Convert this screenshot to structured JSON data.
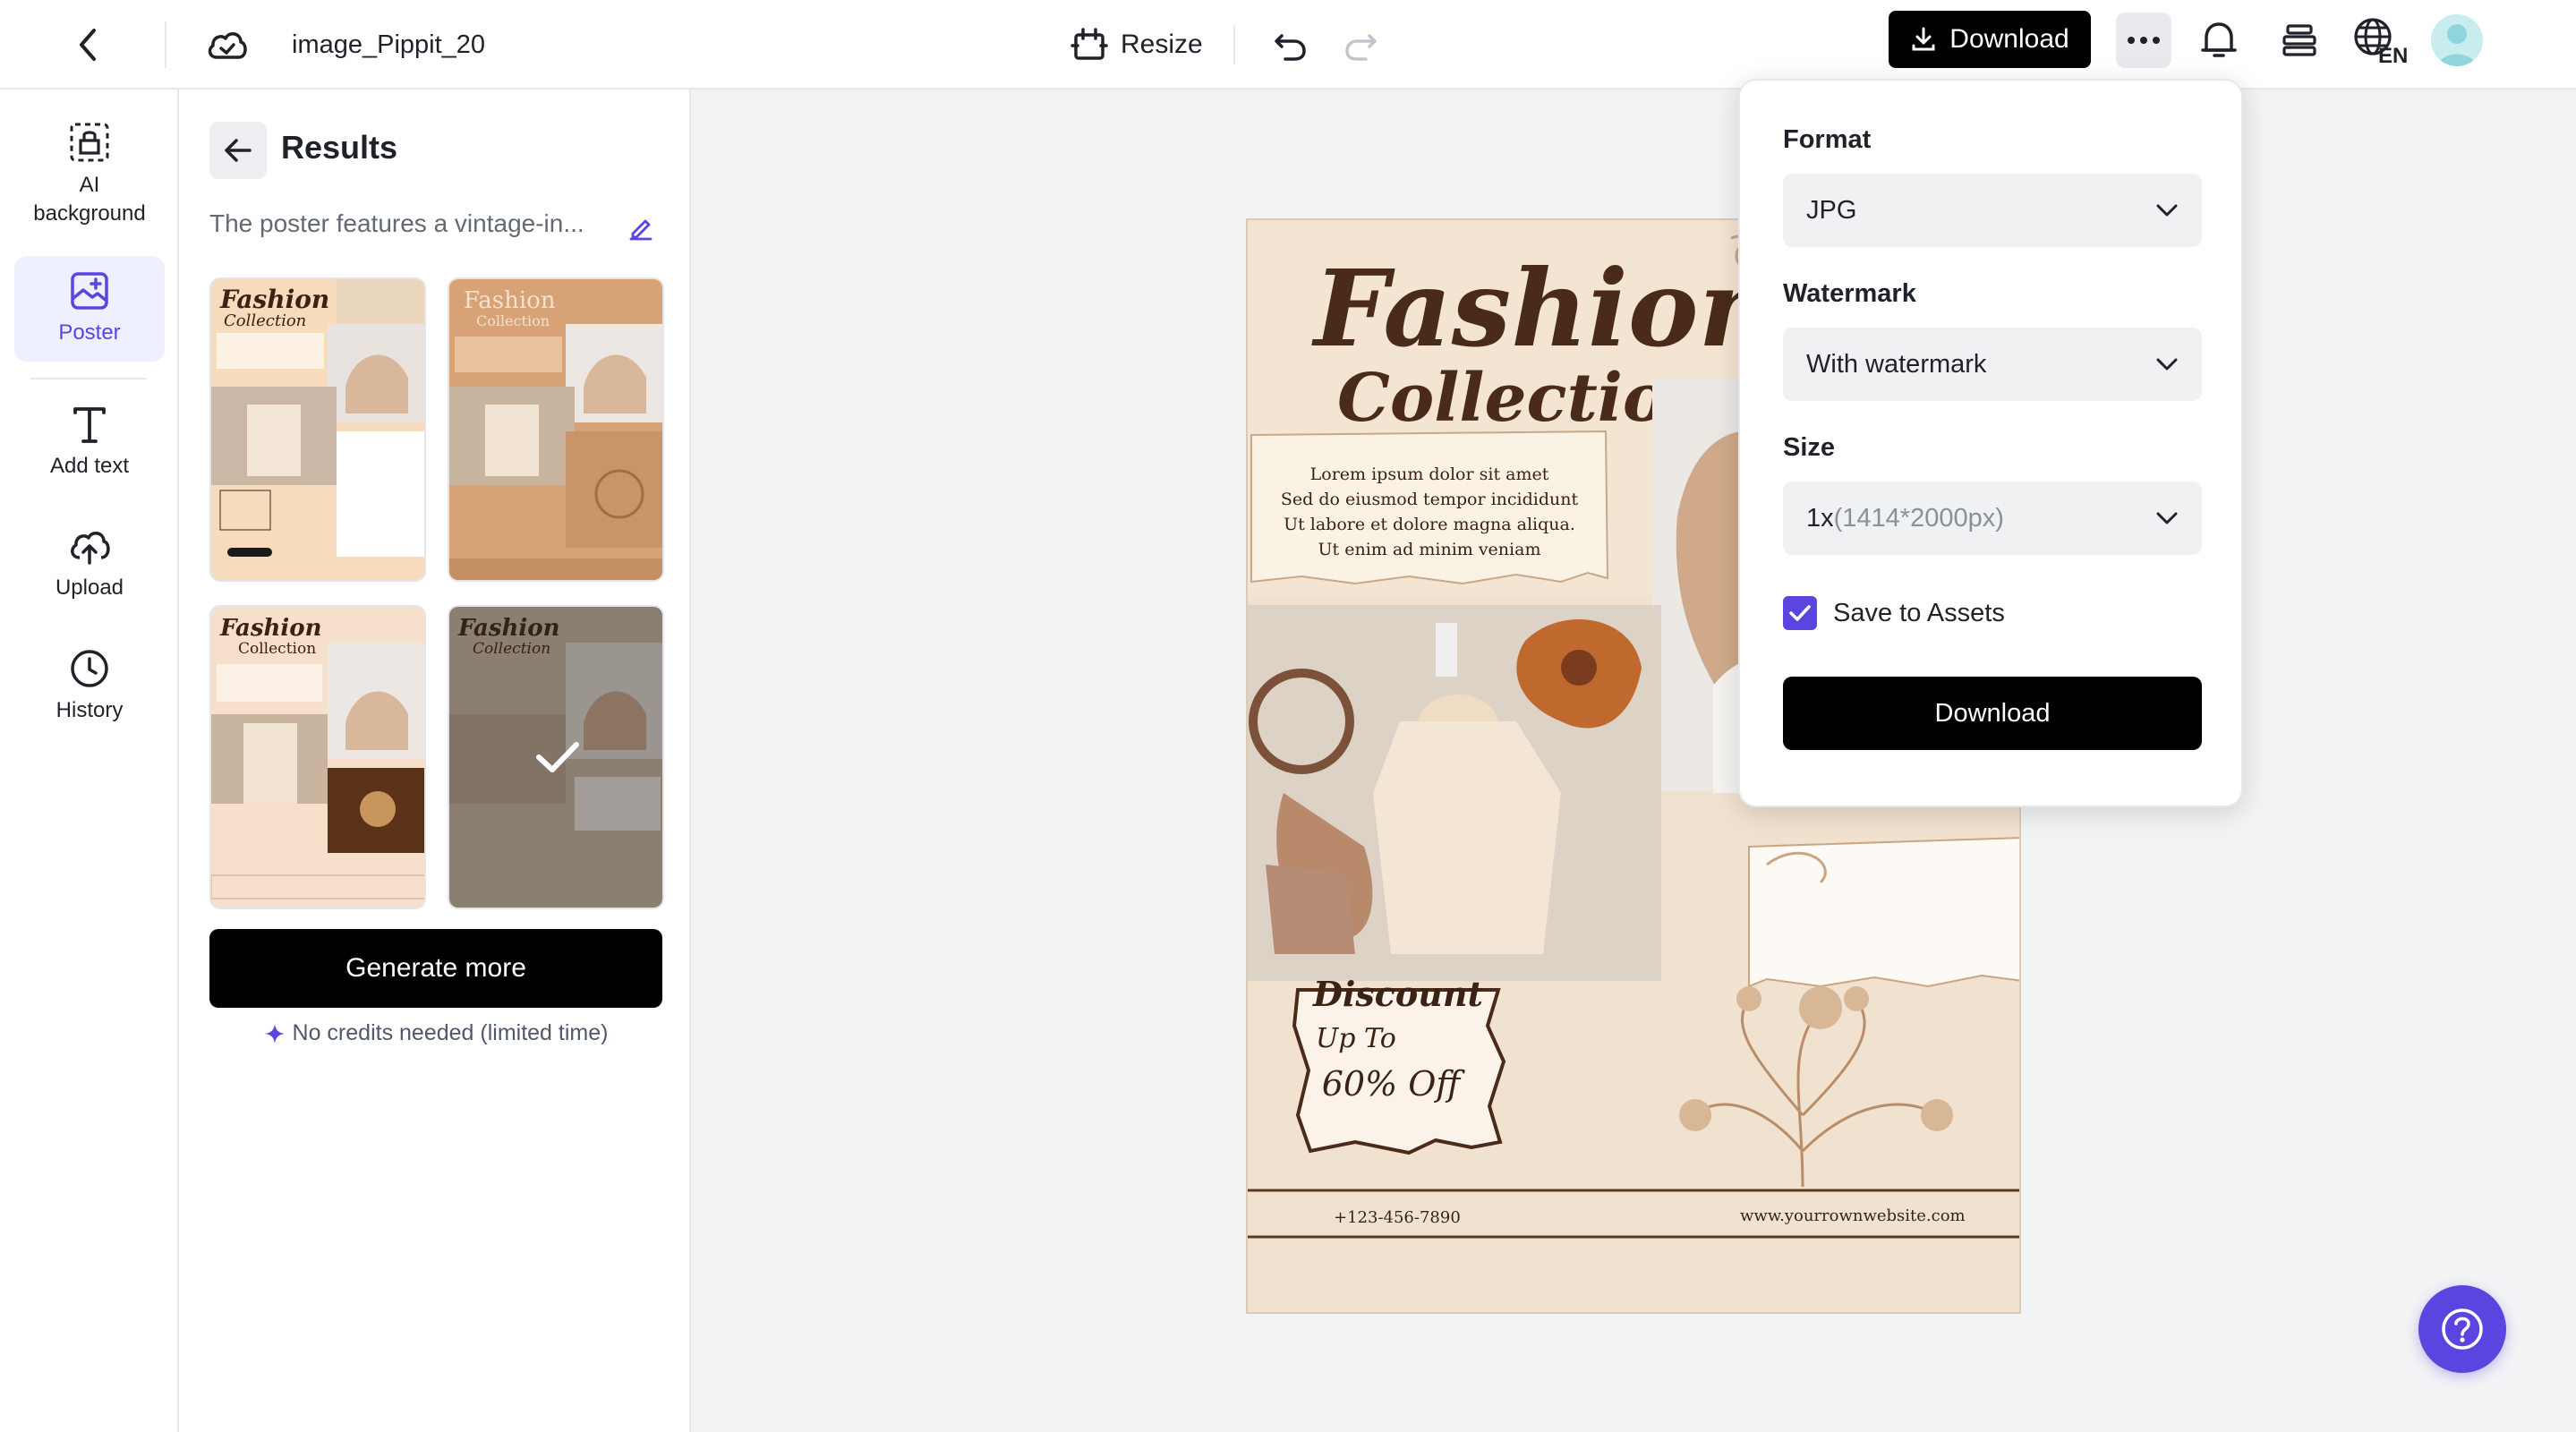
{
  "header": {
    "title": "image_Pippit_20",
    "resize_label": "Resize",
    "download_label": "Download",
    "language_code": "EN"
  },
  "rail": {
    "items": [
      {
        "label": "AI background",
        "icon": "ai-background-icon"
      },
      {
        "label": "Poster",
        "icon": "poster-icon"
      },
      {
        "label": "Add text",
        "icon": "text-icon"
      },
      {
        "label": "Upload",
        "icon": "upload-icon"
      },
      {
        "label": "History",
        "icon": "history-icon"
      }
    ]
  },
  "results": {
    "title": "Results",
    "description": "The poster features a vintage-in...",
    "thumbnails": [
      {
        "title": "Fashion",
        "subtitle": "Collection",
        "selected": false
      },
      {
        "title": "Fashion",
        "subtitle": "Collection",
        "selected": false
      },
      {
        "title": "Fashion",
        "subtitle": "Collection",
        "selected": false
      },
      {
        "title": "Fashion",
        "subtitle": "Collection",
        "selected": true
      }
    ],
    "generate_label": "Generate more",
    "note": "No credits needed (limited time)"
  },
  "poster": {
    "title_line1": "Fashion",
    "title_line2": "Collection",
    "body_lines": [
      "Lorem ipsum dolor sit amet",
      "Sed do eiusmod tempor incididunt",
      "Ut labore et dolore magna aliqua.",
      "Ut enim ad minim veniam"
    ],
    "discount_line1": "Discount",
    "discount_line2": "Up To",
    "discount_line3": "60% Off",
    "phone": "+123-456-7890",
    "website": "www.yourrownwebsite.com"
  },
  "download_panel": {
    "format_label": "Format",
    "format_value": "JPG",
    "watermark_label": "Watermark",
    "watermark_value": "With watermark",
    "size_label": "Size",
    "size_value": "1x",
    "size_detail": "(1414*2000px)",
    "save_label": "Save to Assets",
    "save_checked": true,
    "download_label": "Download"
  },
  "colors": {
    "accent": "#5a45e0",
    "poster_bg": "#f1e1cf",
    "poster_brown": "#4a2b1a"
  }
}
